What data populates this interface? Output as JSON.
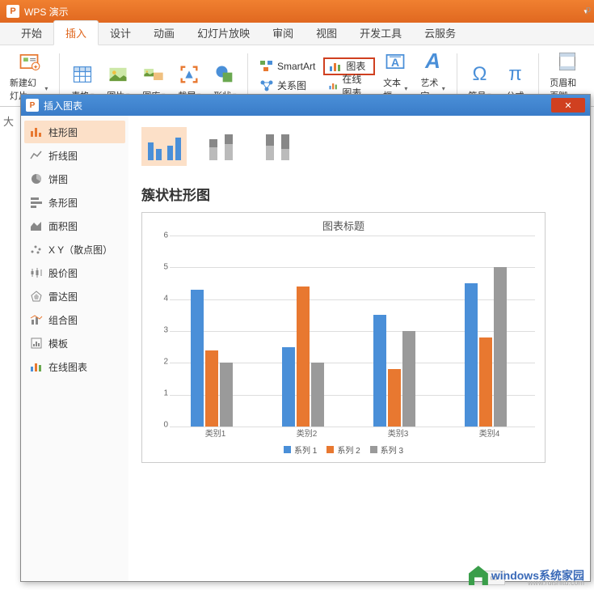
{
  "app": {
    "title": "WPS 演示"
  },
  "title_bar_right": "p",
  "menu_tabs": [
    "开始",
    "插入",
    "设计",
    "动画",
    "幻灯片放映",
    "审阅",
    "视图",
    "开发工具",
    "云服务"
  ],
  "active_tab_index": 1,
  "ribbon": {
    "new_slide": "新建幻灯片",
    "table": "表格",
    "picture": "图片",
    "gallery": "图库",
    "screenshot": "截屏",
    "shapes": "形状",
    "relation": "关系图",
    "smartart": "SmartArt",
    "chart": "图表",
    "online_chart": "在线图表",
    "textbox": "文本框",
    "wordart": "艺术字",
    "symbol": "符号",
    "equation": "公式",
    "header_footer": "页眉和页脚"
  },
  "slide_hint": "大",
  "dialog": {
    "title": "插入图表",
    "close": "✕",
    "chart_types": [
      "柱形图",
      "折线图",
      "饼图",
      "条形图",
      "面积图",
      "X Y（散点图）",
      "股价图",
      "雷达图",
      "组合图",
      "模板",
      "在线图表"
    ],
    "selected_type_index": 0,
    "preview_title": "簇状柱形图"
  },
  "chart_data": {
    "type": "bar",
    "title": "图表标题",
    "categories": [
      "类别1",
      "类别2",
      "类别3",
      "类别4"
    ],
    "series": [
      {
        "name": "系列 1",
        "values": [
          4.3,
          2.5,
          3.5,
          4.5
        ],
        "color": "#4a8fd8"
      },
      {
        "name": "系列 2",
        "values": [
          2.4,
          4.4,
          1.8,
          2.8
        ],
        "color": "#e87830"
      },
      {
        "name": "系列 3",
        "values": [
          2.0,
          2.0,
          3.0,
          5.0
        ],
        "color": "#9a9a9a"
      }
    ],
    "ylim": [
      0,
      6
    ],
    "yticks": [
      0,
      1,
      2,
      3,
      4,
      5,
      6
    ]
  },
  "watermark": {
    "main": "windows系统家园",
    "sub": "www.ruishitu.com"
  }
}
